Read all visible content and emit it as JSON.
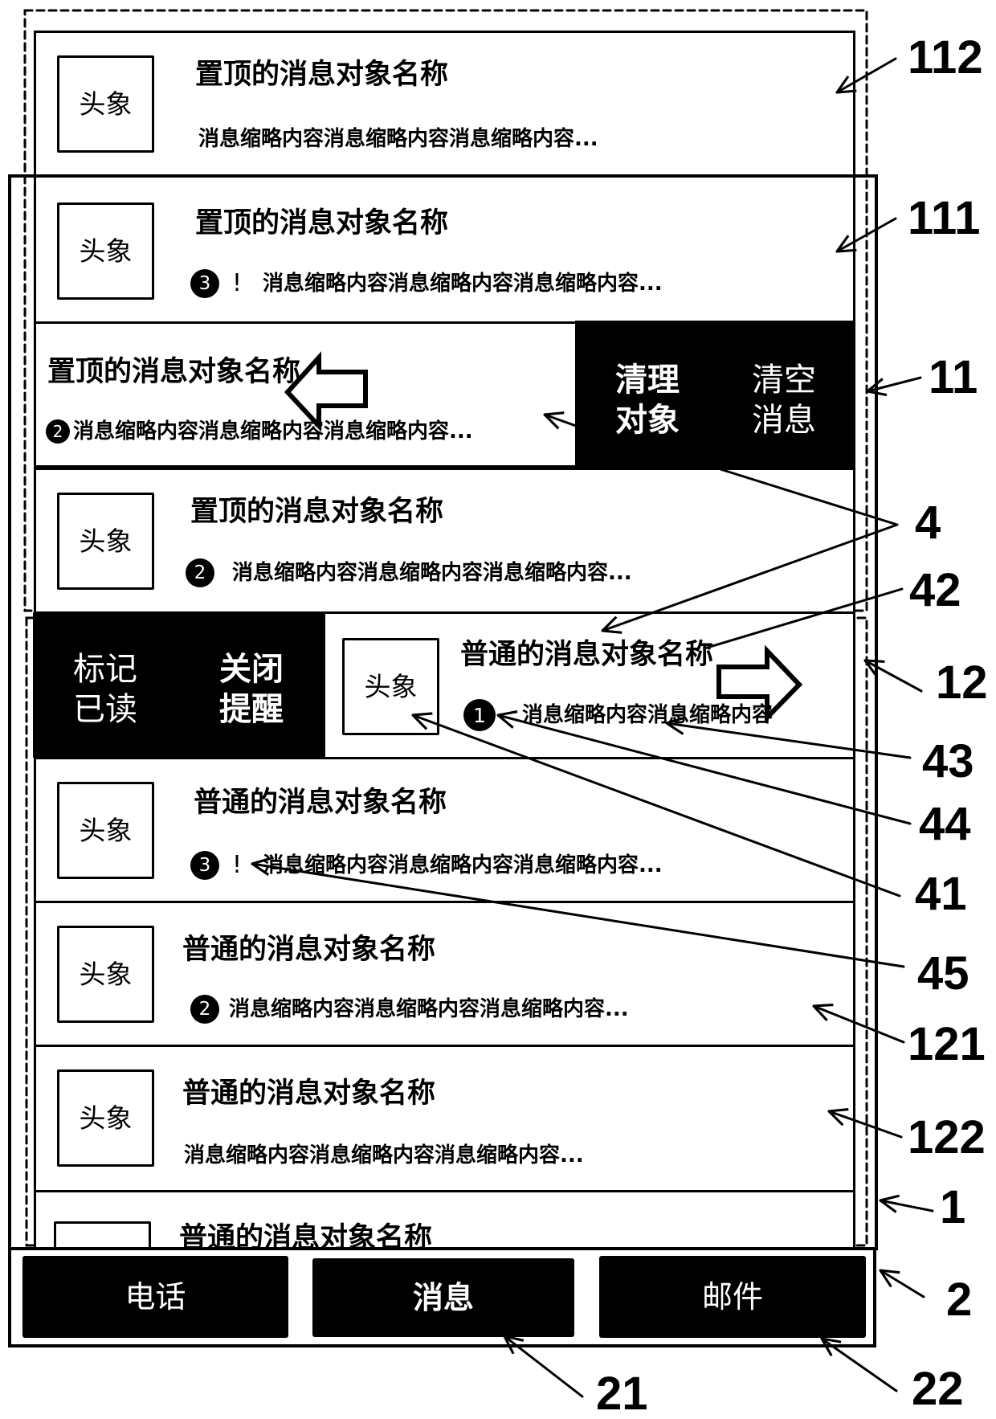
{
  "message_list": {
    "rows": [
      {
        "kind": "pinned",
        "state": "default",
        "avatar": "头象",
        "title": "置顶的消息对象名称",
        "badge": null,
        "alert_mark": null,
        "preview": "消息缩略内容消息缩略内容消息缩略内容..."
      },
      {
        "kind": "pinned",
        "state": "default",
        "avatar": "头象",
        "title": "置顶的消息对象名称",
        "badge": "3",
        "alert_mark": "!",
        "preview": "消息缩略内容消息缩略内容消息缩略内容..."
      },
      {
        "kind": "pinned",
        "state": "swiped-left",
        "title": "置顶的消息对象名称",
        "badge": "2",
        "preview": "消息缩略内容消息缩略内容消息缩略内容...",
        "actions": [
          {
            "id": "clear-contact",
            "label_lines": [
              "清理",
              "对象"
            ],
            "emphasis": "bold"
          },
          {
            "id": "clear-messages",
            "label_lines": [
              "清空",
              "消息"
            ],
            "emphasis": "light"
          }
        ]
      },
      {
        "kind": "pinned",
        "state": "default",
        "avatar": "头象",
        "title": "置顶的消息对象名称",
        "badge": "2",
        "alert_mark": null,
        "preview": "消息缩略内容消息缩略内容消息缩略内容..."
      },
      {
        "kind": "normal",
        "state": "swiped-right",
        "avatar": "头象",
        "title": "普通的消息对象名称",
        "badge": "1",
        "preview": "消息缩略内容消息缩略内容",
        "actions": [
          {
            "id": "mark-read",
            "label_lines": [
              "标记",
              "已读"
            ],
            "emphasis": "light"
          },
          {
            "id": "mute-reminder",
            "label_lines": [
              "关闭",
              "提醒"
            ],
            "emphasis": "bold"
          }
        ]
      },
      {
        "kind": "normal",
        "state": "default",
        "avatar": "头象",
        "title": "普通的消息对象名称",
        "badge": "3",
        "alert_mark": "!",
        "preview": "消息缩略内容消息缩略内容消息缩略内容..."
      },
      {
        "kind": "normal",
        "state": "default",
        "avatar": "头象",
        "title": "普通的消息对象名称",
        "badge": "2",
        "alert_mark": null,
        "preview": "消息缩略内容消息缩略内容消息缩略内容..."
      },
      {
        "kind": "normal",
        "state": "default",
        "avatar": "头象",
        "title": "普通的消息对象名称",
        "badge": null,
        "alert_mark": null,
        "preview": "消息缩略内容消息缩略内容消息缩略内容..."
      },
      {
        "kind": "normal",
        "state": "partially-visible",
        "title": "普通的消息对象名称"
      }
    ]
  },
  "tab_bar": {
    "tabs": [
      {
        "label": "电话",
        "active": false
      },
      {
        "label": "消息",
        "active": true
      },
      {
        "label": "邮件",
        "active": false
      }
    ]
  },
  "reference_labels": {
    "r112": "112",
    "r111": "111",
    "r11": "11",
    "r4": "4",
    "r42": "42",
    "r12": "12",
    "r43": "43",
    "r44": "44",
    "r41": "41",
    "r45": "45",
    "r121": "121",
    "r122": "122",
    "r1": "1",
    "r2": "2",
    "r21": "21",
    "r22": "22"
  },
  "colors": {
    "ink": "#000000",
    "paper": "#ffffff"
  }
}
